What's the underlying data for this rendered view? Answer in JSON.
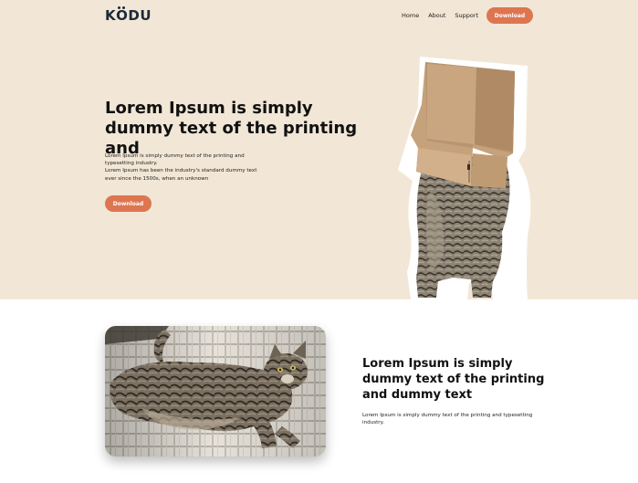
{
  "brand": {
    "logo_text": "KODU",
    "logo_part1": "K",
    "logo_part2": "O",
    "logo_part3": "DU"
  },
  "nav": {
    "items": [
      {
        "label": "Home"
      },
      {
        "label": "About"
      },
      {
        "label": "Support"
      }
    ],
    "cta_label": "Download"
  },
  "hero": {
    "title": "Lorem Ipsum is simply dummy text of the printing and",
    "description_line1": "Lorem Ipsum is simply dummy text of the printing and typesetting industry.",
    "description_line2": "Lorem Ipsum has been the industry's standard dummy text ever since the 1500s, when an unknown",
    "cta_label": "Download",
    "image_alt": "cat-with-box-on-head"
  },
  "feature": {
    "title": "Lorem Ipsum is simply dummy text of the printing and dummy text",
    "description": "Lorem Ipsum is simply dummy text of the printing and typesetting industry.",
    "image_alt": "cat-lying-on-bed"
  },
  "colors": {
    "hero_background": "#f2e7d6",
    "accent": "#dd7650",
    "logo": "#1d2a3a"
  }
}
